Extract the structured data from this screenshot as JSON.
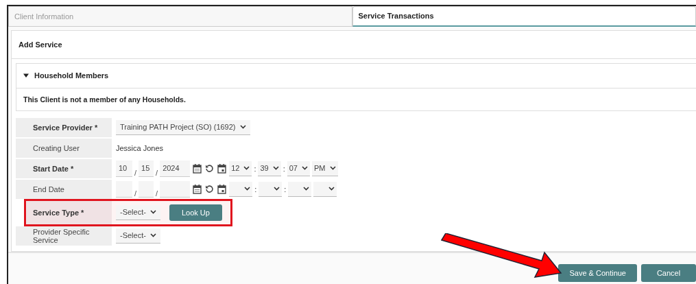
{
  "tabs": [
    {
      "label": "Client Information",
      "selected": false
    },
    {
      "label": "Service Transactions",
      "selected": true
    }
  ],
  "section": {
    "title": "Add Service"
  },
  "household": {
    "title": "Household Members",
    "expanded": true,
    "message": "This Client is not a member of any Households."
  },
  "form_rows": [
    {
      "kind": "select",
      "label": "Service Provider *",
      "required": true,
      "value": "Training PATH Project (SO) (1692)",
      "highlighted": false
    },
    {
      "kind": "text",
      "label": "Creating User",
      "required": false,
      "value": "Jessica Jones",
      "highlighted": false
    },
    {
      "kind": "datetime",
      "label": "Start Date *",
      "required": true,
      "month": "10",
      "day": "15",
      "year": "2024",
      "date_separator": "/",
      "time_separator": ":",
      "hour": "12",
      "minute": "39",
      "second": "07",
      "ampm": "PM",
      "highlighted": false
    },
    {
      "kind": "datetime",
      "label": "End Date",
      "required": false,
      "date_separator": "/",
      "time_separator": ":",
      "highlighted": false
    },
    {
      "kind": "select_lookup",
      "label": "Service Type *",
      "required": true,
      "value": "-Select-",
      "button": "Look Up",
      "highlighted": true
    },
    {
      "kind": "select",
      "label": "Provider Specific Service",
      "required": false,
      "value": "-Select-",
      "highlighted": false
    }
  ],
  "buttons": [
    {
      "label": "Save & Continue"
    },
    {
      "label": "Cancel"
    }
  ]
}
